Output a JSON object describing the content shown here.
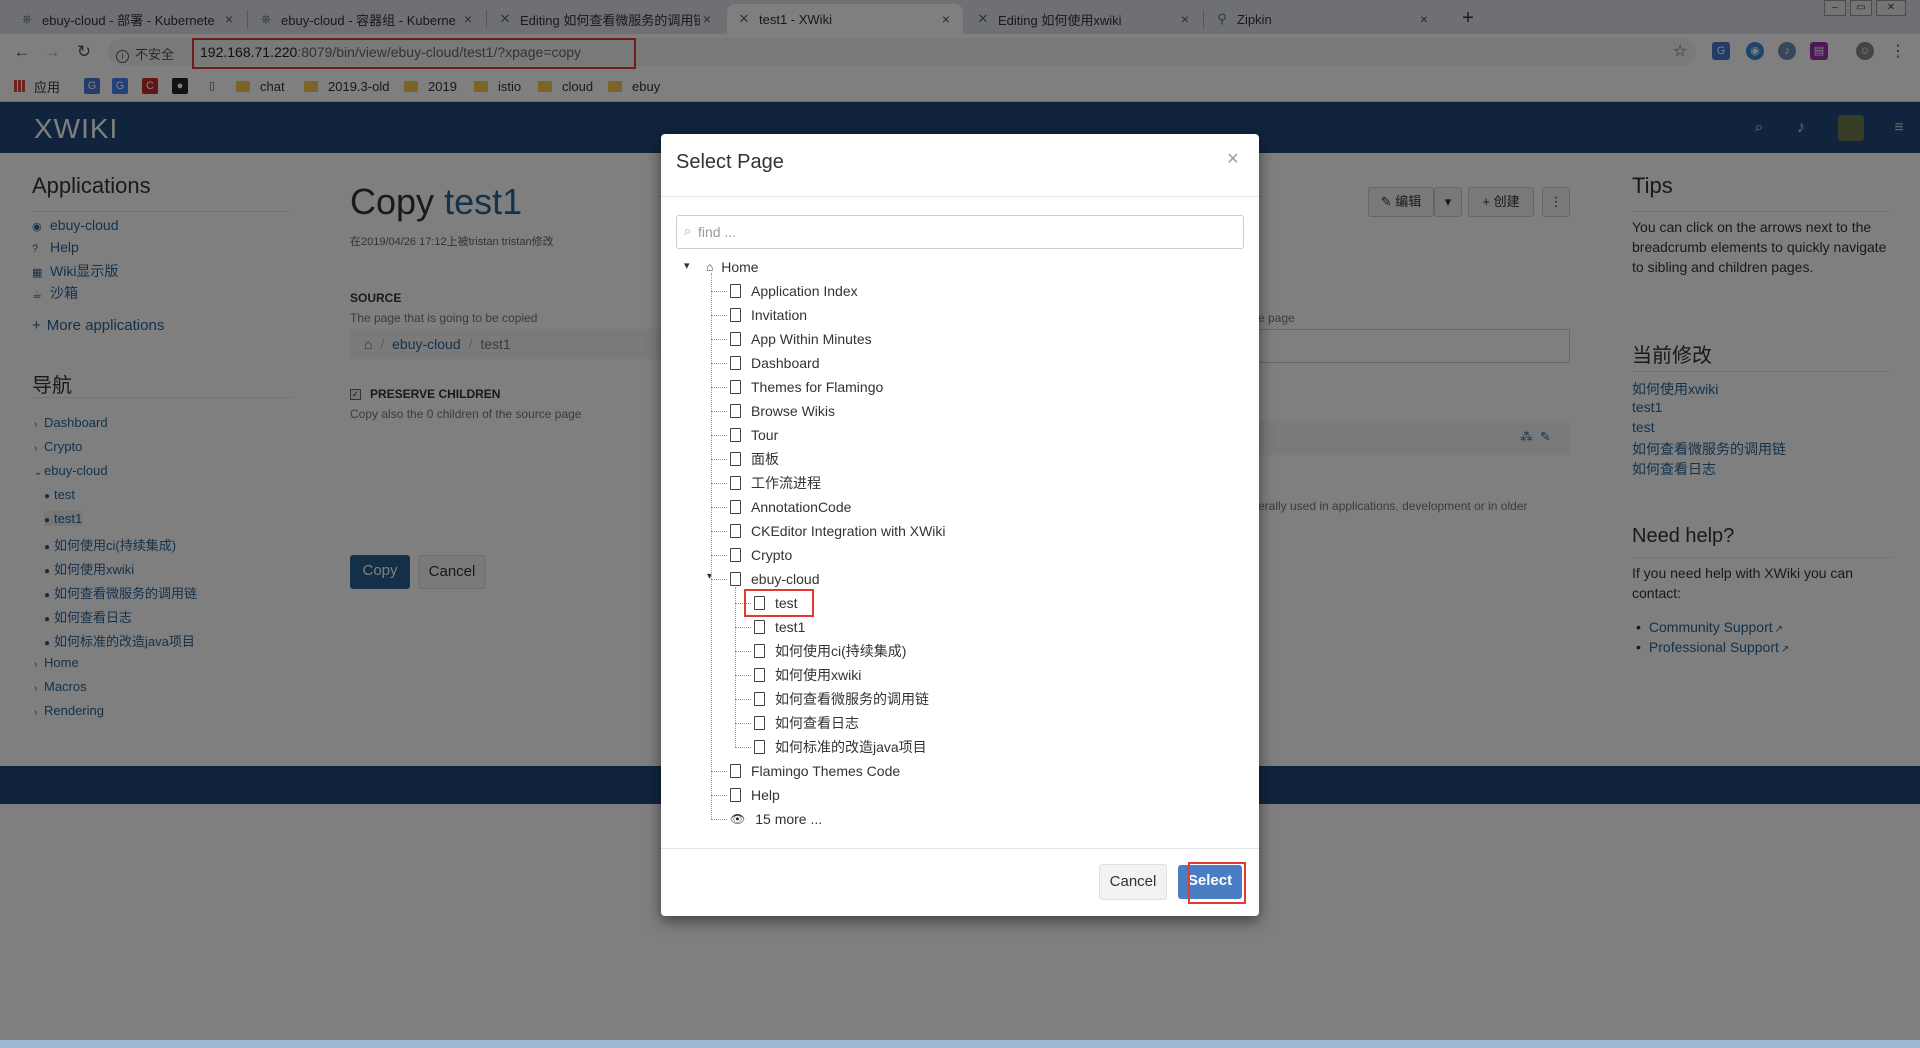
{
  "browser": {
    "tabs": [
      {
        "title": "ebuy-cloud - 部署 - Kubernete",
        "icon": "kubernetes-icon"
      },
      {
        "title": "ebuy-cloud - 容器组 - Kuberne",
        "icon": "kubernetes-icon"
      },
      {
        "title": "Editing 如何查看微服务的调用链",
        "icon": "xwiki-icon"
      },
      {
        "title": "test1 - XWiki",
        "icon": "xwiki-icon"
      },
      {
        "title": "Editing 如何使用xwiki",
        "icon": "xwiki-icon"
      },
      {
        "title": "Zipkin",
        "icon": "zipkin-icon"
      }
    ],
    "close_glyph": "×",
    "newtab_glyph": "+",
    "insecure_label": "不安全",
    "url_host": "192.168.71.220",
    "url_rest": ":8079/bin/view/ebuy-cloud/test1/?xpage=copy",
    "bookmarks": [
      "应用",
      "chat",
      "2019.3-old",
      "2019",
      "istio",
      "cloud",
      "ebuy"
    ]
  },
  "xwiki": {
    "logo": "XWIKI",
    "left": {
      "applications_title": "Applications",
      "applications": [
        "ebuy-cloud",
        "Help",
        "Wiki显示版",
        "沙箱"
      ],
      "more_apps": "More applications",
      "nav_title": "导航",
      "nav": [
        {
          "label": "Dashboard",
          "level": 0,
          "kind": "collapsed"
        },
        {
          "label": "Crypto",
          "level": 0,
          "kind": "collapsed"
        },
        {
          "label": "ebuy-cloud",
          "level": 0,
          "kind": "expanded"
        },
        {
          "label": "test",
          "level": 1,
          "kind": "leaf"
        },
        {
          "label": "test1",
          "level": 1,
          "kind": "leaf"
        },
        {
          "label": "如何使用ci(持续集成)",
          "level": 1,
          "kind": "leaf"
        },
        {
          "label": "如何使用xwiki",
          "level": 1,
          "kind": "leaf"
        },
        {
          "label": "如何查看微服务的调用链",
          "level": 1,
          "kind": "leaf"
        },
        {
          "label": "如何查看日志",
          "level": 1,
          "kind": "leaf"
        },
        {
          "label": "如何标准的改造java项目",
          "level": 1,
          "kind": "leaf"
        },
        {
          "label": "Home",
          "level": 0,
          "kind": "collapsed"
        },
        {
          "label": "Macros",
          "level": 0,
          "kind": "collapsed"
        },
        {
          "label": "Rendering",
          "level": 0,
          "kind": "collapsed"
        }
      ]
    },
    "main": {
      "title_prefix": "Copy",
      "title_page": "test1",
      "meta": "在2019/04/26 17:12上被tristan tristan修改",
      "edit_label": "编辑",
      "create_label": "创建",
      "source_heading": "SOURCE",
      "source_hint": "The page that is going to be copied",
      "breadcrumb": [
        "ebuy-cloud",
        "test1"
      ],
      "breadcrumb_sep": "/",
      "preserve_label": "PRESERVE CHILDREN",
      "preserve_hint": "Copy also the 0 children of the source page",
      "target_hint_fragment": "e page",
      "notice_fragment": "erally used in applications, development or in older",
      "copy_btn": "Copy",
      "cancel_btn": "Cancel"
    },
    "right": {
      "tips_title": "Tips",
      "tips_text": "You can click on the arrows next to the breadcrumb elements to quickly navigate to sibling and children pages.",
      "recent_title": "当前修改",
      "recent": [
        "如何使用xwiki",
        "test1",
        "test",
        "如何查看微服务的调用链",
        "如何查看日志"
      ],
      "help_title": "Need help?",
      "help_text": "If you need help with XWiki you can contact:",
      "help_links": [
        "Community Support",
        "Professional Support"
      ]
    }
  },
  "modal": {
    "title": "Select Page",
    "close": "×",
    "find_placeholder": "find ...",
    "tree_root": "Home",
    "tree_children": [
      "Application Index",
      "Invitation",
      "App Within Minutes",
      "Dashboard",
      "Themes for Flamingo",
      "Browse Wikis",
      "Tour",
      "面板",
      "工作流进程",
      "AnnotationCode",
      "CKEditor Integration with XWiki",
      "Crypto",
      "ebuy-cloud"
    ],
    "ebuy_children": [
      "test",
      "test1",
      "如何使用ci(持续集成)",
      "如何使用xwiki",
      "如何查看微服务的调用链",
      "如何查看日志",
      "如何标准的改造java项目"
    ],
    "tree_after": [
      "Flamingo Themes Code",
      "Help"
    ],
    "more": "15 more ...",
    "selected": "test",
    "cancel_btn": "Cancel",
    "select_btn": "Select"
  },
  "colors": {
    "header": "#23497b",
    "link": "#2a6496",
    "primary": "#286090",
    "highlight": "#e53935"
  }
}
